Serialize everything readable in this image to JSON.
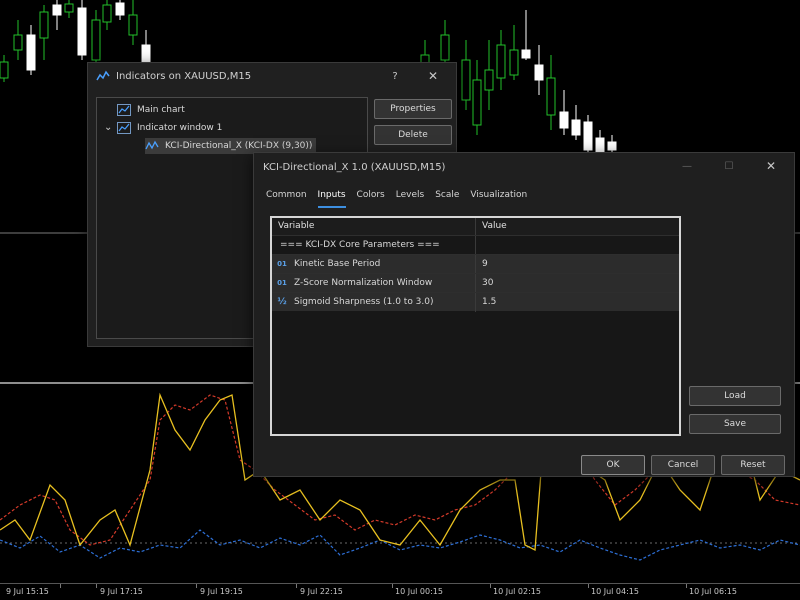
{
  "time_axis": {
    "labels": [
      "9 Jul 15:15",
      "9 Jul 17:15",
      "9 Jul 19:15",
      "9 Jul 22:15",
      "10 Jul 00:15",
      "10 Jul 02:15",
      "10 Jul 04:15",
      "10 Jul 06:15"
    ]
  },
  "indicators_window": {
    "title": "Indicators on XAUUSD,M15",
    "help_label": "?",
    "close_label": "✕",
    "tree": {
      "main_chart": "Main chart",
      "indicator_window": "Indicator window 1",
      "indicator_item": "KCI-Directional_X (KCI-DX (9,30))"
    },
    "properties_label": "Properties",
    "delete_label": "Delete"
  },
  "inputs_window": {
    "title": "KCI-Directional_X 1.0 (XAUUSD,M15)",
    "minimize_label": "—",
    "maximize_label": "☐",
    "close_label": "✕",
    "tabs": [
      "Common",
      "Inputs",
      "Colors",
      "Levels",
      "Scale",
      "Visualization"
    ],
    "active_tab": "Inputs",
    "columns": {
      "variable": "Variable",
      "value": "Value"
    },
    "section_header": "=== KCI-DX Core Parameters ===",
    "rows": [
      {
        "type_icon": "01",
        "variable": "Kinetic Base Period",
        "value": "9"
      },
      {
        "type_icon": "01",
        "variable": "Z-Score Normalization Window",
        "value": "30"
      },
      {
        "type_icon": "½",
        "variable": "Sigmoid Sharpness (1.0 to 3.0)",
        "value": "1.5"
      }
    ],
    "load_label": "Load",
    "save_label": "Save",
    "ok_label": "OK",
    "cancel_label": "Cancel",
    "reset_label": "Reset"
  },
  "colors": {
    "bull": "#22c12a",
    "bear": "#ffffff",
    "line_yellow": "#e8c020",
    "line_red": "#d43a2a",
    "line_blue": "#2d6fd6",
    "accent": "#3d8fe0"
  }
}
